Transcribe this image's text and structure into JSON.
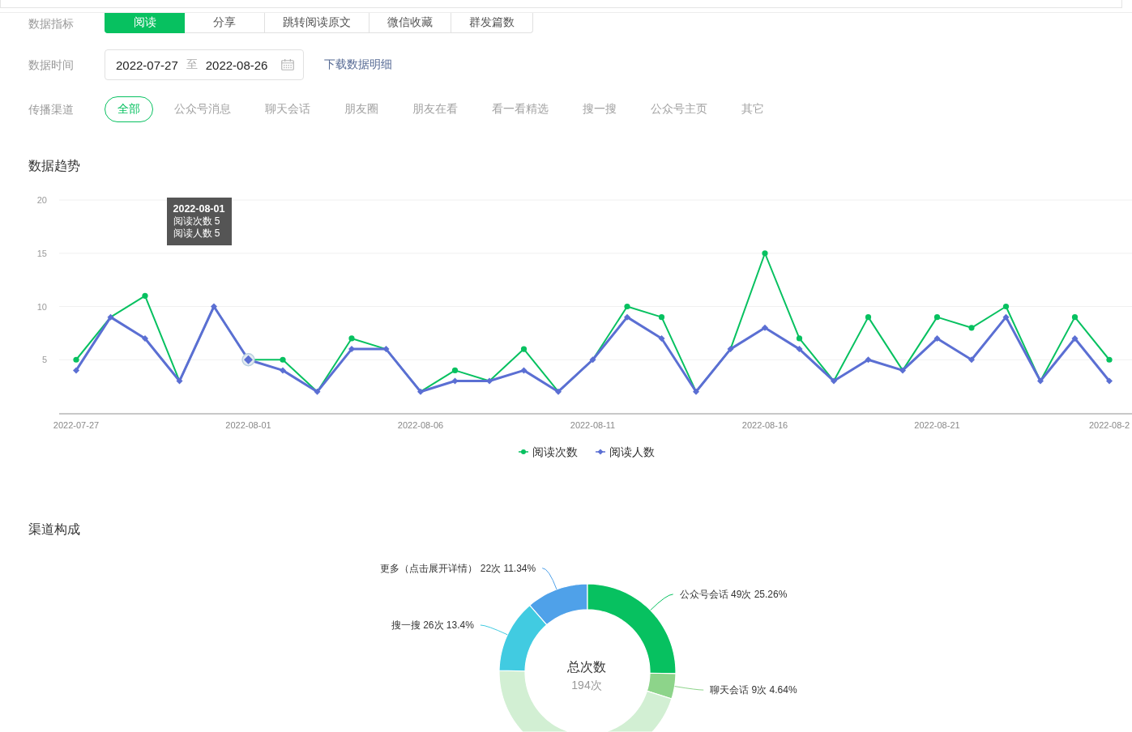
{
  "filters": {
    "metrics": {
      "label": "数据指标",
      "tabs": [
        {
          "label": "阅读",
          "selected": true
        },
        {
          "label": "分享",
          "selected": false
        },
        {
          "label": "跳转阅读原文",
          "selected": false
        },
        {
          "label": "微信收藏",
          "selected": false
        },
        {
          "label": "群发篇数",
          "selected": false
        }
      ]
    },
    "date": {
      "label": "数据时间",
      "start": "2022-07-27",
      "separator": "至",
      "end": "2022-08-26",
      "download_link": "下载数据明细"
    },
    "channels": {
      "label": "传播渠道",
      "items": [
        {
          "label": "全部",
          "selected": true
        },
        {
          "label": "公众号消息",
          "selected": false
        },
        {
          "label": "聊天会话",
          "selected": false
        },
        {
          "label": "朋友圈",
          "selected": false
        },
        {
          "label": "朋友在看",
          "selected": false
        },
        {
          "label": "看一看精选",
          "selected": false
        },
        {
          "label": "搜一搜",
          "selected": false
        },
        {
          "label": "公众号主页",
          "selected": false
        },
        {
          "label": "其它",
          "selected": false
        }
      ]
    }
  },
  "trend": {
    "title": "数据趋势",
    "chart_data": {
      "type": "line",
      "categories": [
        "2022-07-27",
        null,
        null,
        null,
        null,
        "2022-08-01",
        null,
        null,
        null,
        null,
        "2022-08-06",
        null,
        null,
        null,
        null,
        "2022-08-11",
        null,
        null,
        null,
        null,
        "2022-08-16",
        null,
        null,
        null,
        null,
        "2022-08-21",
        null,
        null,
        null,
        null,
        "2022-08-2"
      ],
      "ylim": [
        0,
        20
      ],
      "yticks": [
        5,
        10,
        15,
        20
      ],
      "grid": true,
      "series": [
        {
          "name": "阅读次数",
          "color": "#07c160",
          "marker": "circle",
          "values": [
            5,
            9,
            11,
            3,
            10,
            5,
            5,
            2,
            7,
            6,
            2,
            4,
            3,
            6,
            2,
            5,
            10,
            9,
            2,
            6,
            15,
            7,
            3,
            9,
            4,
            9,
            8,
            10,
            3,
            9,
            5
          ]
        },
        {
          "name": "阅读人数",
          "color": "#5b6fd3",
          "marker": "diamond",
          "values": [
            4,
            9,
            7,
            3,
            10,
            5,
            4,
            2,
            6,
            6,
            2,
            3,
            3,
            4,
            2,
            5,
            9,
            7,
            2,
            6,
            8,
            6,
            3,
            5,
            4,
            7,
            5,
            9,
            3,
            7,
            3
          ]
        }
      ]
    },
    "tooltip": {
      "date": "2022-08-01",
      "lines": [
        "阅读次数 5",
        "阅读人数 5"
      ]
    }
  },
  "composition": {
    "title": "渠道构成",
    "center_label": "总次数",
    "center_value": "194次",
    "chart_data": {
      "type": "donut",
      "values": [
        11.34,
        25.26,
        4.64,
        45.36,
        13.4
      ]
    },
    "slices": [
      {
        "label": "更多（点击展开详情） 22次 11.34%",
        "color": "#4fa1e9"
      },
      {
        "label": "公众号会话 49次 25.26%",
        "color": "#07c160"
      },
      {
        "label": "聊天会话 9次 4.64%",
        "color": "#8dd48a"
      },
      {
        "color": "#d2efd3"
      },
      {
        "label": "搜一搜 26次 13.4%",
        "color": "#41cbe1"
      }
    ]
  }
}
